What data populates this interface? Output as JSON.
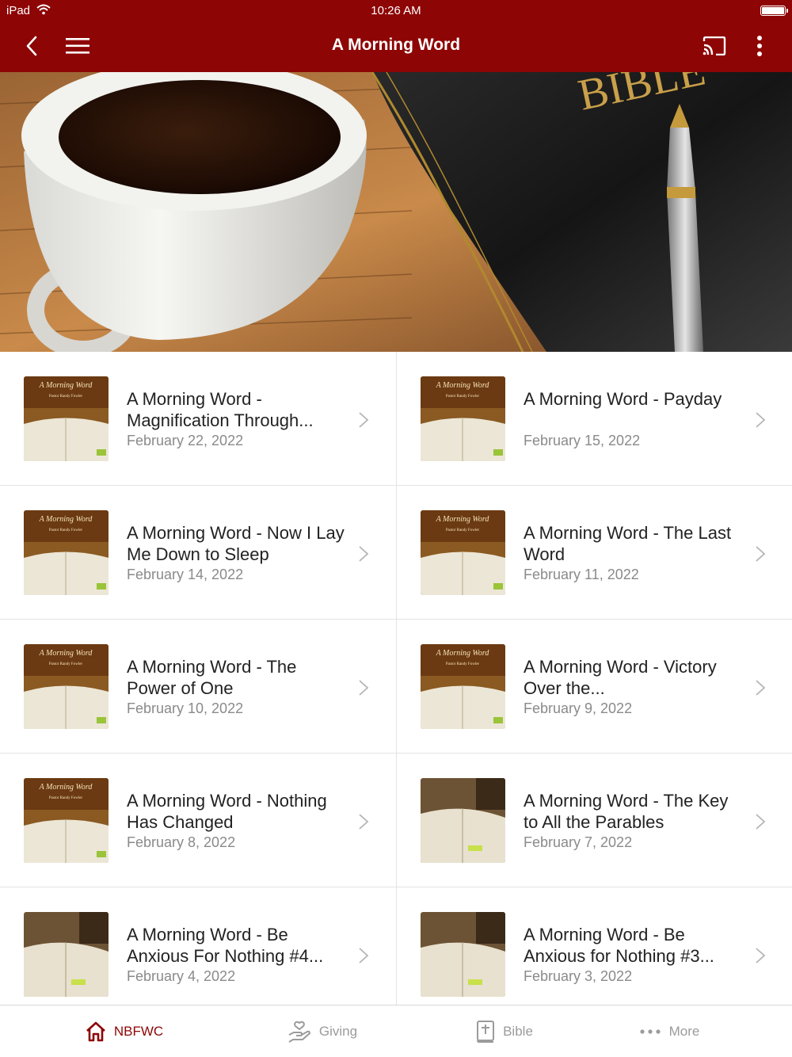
{
  "status_bar": {
    "device": "iPad",
    "time": "10:26 AM"
  },
  "nav": {
    "title": "A Morning Word",
    "back_icon": "chevron-left-icon",
    "menu_icon": "hamburger-menu-icon",
    "cast_icon": "cast-icon",
    "more_icon": "more-vertical-icon"
  },
  "colors": {
    "brand": "#8e0505",
    "date_text": "#8a8a8a",
    "inactive_tab": "#9b9b9b"
  },
  "items": [
    {
      "title": "A Morning Word - Magnification Through...",
      "date": "February 22, 2022",
      "thumb": "morning-word-cover"
    },
    {
      "title": "A Morning Word - Payday",
      "date": "February 15, 2022",
      "thumb": "morning-word-cover"
    },
    {
      "title": "A Morning Word - Now I Lay Me Down to Sleep",
      "date": "February 14, 2022",
      "thumb": "morning-word-cover"
    },
    {
      "title": "A Morning Word - The Last Word",
      "date": "February 11, 2022",
      "thumb": "morning-word-cover"
    },
    {
      "title": "A Morning Word - The Power of One",
      "date": "February 10, 2022",
      "thumb": "morning-word-cover"
    },
    {
      "title": "A Morning Word - Victory Over the...",
      "date": "February 9, 2022",
      "thumb": "morning-word-cover"
    },
    {
      "title": "A Morning Word - Nothing Has Changed",
      "date": "February 8, 2022",
      "thumb": "morning-word-cover"
    },
    {
      "title": "A Morning Word - The Key to All the Parables",
      "date": "February 7, 2022",
      "thumb": "bible-photo"
    },
    {
      "title": "A Morning Word - Be Anxious For Nothing #4...",
      "date": "February 4, 2022",
      "thumb": "bible-photo"
    },
    {
      "title": "A Morning Word - Be Anxious for Nothing #3...",
      "date": "February 3, 2022",
      "thumb": "bible-photo"
    }
  ],
  "tabs": [
    {
      "label": "NBFWC",
      "icon": "home-icon",
      "active": true
    },
    {
      "label": "Giving",
      "icon": "giving-hand-icon",
      "active": false
    },
    {
      "label": "Bible",
      "icon": "bible-icon",
      "active": false
    },
    {
      "label": "More",
      "icon": "more-dots-icon",
      "active": false
    }
  ]
}
